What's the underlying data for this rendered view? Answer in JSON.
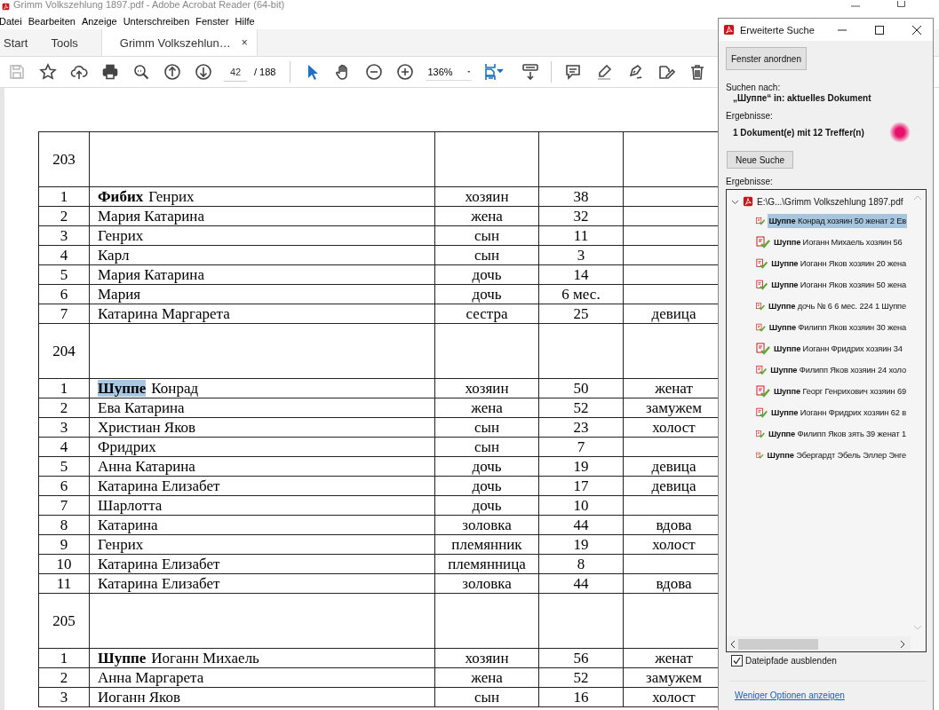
{
  "app_window": {
    "title": "Grimm Volkszehlung 1897.pdf - Adobe Acrobat Reader (64-bit)"
  },
  "menu": [
    "Datei",
    "Bearbeiten",
    "Anzeige",
    "Unterschreiben",
    "Fenster",
    "Hilfe"
  ],
  "tabs": [
    {
      "label": "Start",
      "selected": false
    },
    {
      "label": "Tools",
      "selected": false
    },
    {
      "label": "Grimm Volkszehlun…",
      "selected": true,
      "close": "×"
    }
  ],
  "toolbar": [
    {
      "kind": "save",
      "active": false,
      "disabled": true
    },
    {
      "kind": "bookmark",
      "active": false,
      "disabled": false
    },
    {
      "kind": "upload",
      "active": false,
      "disabled": false
    },
    {
      "kind": "print",
      "active": false,
      "disabled": false
    },
    {
      "kind": "find",
      "active": false,
      "disabled": false
    },
    {
      "kind": "prev",
      "active": false,
      "disabled": false
    },
    {
      "kind": "next",
      "active": false,
      "disabled": false
    },
    {
      "kind": "page",
      "value": "42",
      "total": "/ 188"
    },
    {
      "kind": "separator"
    },
    {
      "kind": "select",
      "active": true,
      "disabled": false
    },
    {
      "kind": "hand",
      "active": false,
      "disabled": false
    },
    {
      "kind": "zoomout",
      "active": false,
      "disabled": false
    },
    {
      "kind": "zoomin",
      "active": false,
      "disabled": false
    },
    {
      "kind": "zoom",
      "value": "136%"
    },
    {
      "kind": "fit",
      "active": true,
      "disabled": false
    },
    {
      "kind": "scroll",
      "active": false,
      "disabled": false
    },
    {
      "kind": "separator"
    },
    {
      "kind": "comment",
      "active": false,
      "disabled": false
    },
    {
      "kind": "highlight",
      "active": false,
      "disabled": false
    },
    {
      "kind": "sign",
      "active": false,
      "disabled": false
    },
    {
      "kind": "fill",
      "active": false,
      "disabled": false
    },
    {
      "kind": "delete",
      "active": false,
      "disabled": false
    }
  ],
  "document": {
    "rows": [
      {
        "kind": "group",
        "num": "203"
      },
      {
        "kind": "person",
        "num": "1",
        "surname": "Фибих",
        "given": "Генрих",
        "role": "хозяин",
        "age": "38",
        "hit": false
      },
      {
        "kind": "person",
        "num": "2",
        "given": "Мария Катарина",
        "role": "жена",
        "age": "32"
      },
      {
        "kind": "person",
        "num": "3",
        "given": "Генрих",
        "role": "сын",
        "age": "11"
      },
      {
        "kind": "person",
        "num": "4",
        "given": "Карл",
        "role": "сын",
        "age": "3"
      },
      {
        "kind": "person",
        "num": "5",
        "given": "Мария Катарина",
        "role": "дочь",
        "age": "14"
      },
      {
        "kind": "person",
        "num": "6",
        "given": "Мария",
        "role": "дочь",
        "age": "6 мес."
      },
      {
        "kind": "person",
        "num": "7",
        "given": "Катарина Маргарета",
        "role": "сестра",
        "age": "25",
        "status": "девица"
      },
      {
        "kind": "group",
        "num": "204"
      },
      {
        "kind": "person",
        "num": "1",
        "surname": "Шуппе",
        "given": "Конрад",
        "role": "хозяин",
        "age": "50",
        "status": "женат",
        "hit": true
      },
      {
        "kind": "person",
        "num": "2",
        "given": "Ева Катарина",
        "role": "жена",
        "age": "52",
        "status": "замужем"
      },
      {
        "kind": "person",
        "num": "3",
        "given": "Христиан Яков",
        "role": "сын",
        "age": "23",
        "status": "холост"
      },
      {
        "kind": "person",
        "num": "4",
        "given": "Фридрих",
        "role": "сын",
        "age": "7"
      },
      {
        "kind": "person",
        "num": "5",
        "given": "Анна Катарина",
        "role": "дочь",
        "age": "19",
        "status": "девица"
      },
      {
        "kind": "person",
        "num": "6",
        "given": "Катарина Елизабет",
        "role": "дочь",
        "age": "17",
        "status": "девица"
      },
      {
        "kind": "person",
        "num": "7",
        "given": "Шарлотта",
        "role": "дочь",
        "age": "10"
      },
      {
        "kind": "person",
        "num": "8",
        "given": "Катарина",
        "role": "золовка",
        "age": "44",
        "status": "вдова"
      },
      {
        "kind": "person",
        "num": "9",
        "given": "Генрих",
        "role": "племянник",
        "age": "19",
        "status": "холост"
      },
      {
        "kind": "person",
        "num": "10",
        "given": "Катарина Елизабет",
        "role": "племянница",
        "age": "8"
      },
      {
        "kind": "person",
        "num": "11",
        "given": "Катарина Елизабет",
        "role": "золовка",
        "age": "44",
        "status": "вдова"
      },
      {
        "kind": "group",
        "num": "205"
      },
      {
        "kind": "person",
        "num": "1",
        "surname": "Шуппе",
        "given": "Иоганн Михаель",
        "role": "хозяин",
        "age": "56",
        "status": "женат",
        "hit": false
      },
      {
        "kind": "person",
        "num": "2",
        "given": "Анна Маргарета",
        "role": "жена",
        "age": "52",
        "status": "замужем"
      },
      {
        "kind": "person",
        "num": "3",
        "given": "Иоганн Яков",
        "role": "сын",
        "age": "16",
        "status": "холост"
      }
    ]
  },
  "search_dialog": {
    "title": "Erweiterte Suche",
    "arrange_button": "Fenster anordnen",
    "search_label": "Suchen nach:",
    "search_query": "„Шуппе“ in: aktuelles Dokument",
    "summary_label": "Ergebnisse:",
    "summary": "1 Dokument(e) mit 12 Treffer(n)",
    "new_search_button": "Neue Suche",
    "results_label": "Ergebnisse:",
    "results": {
      "file": "E:\\G...\\Grimm Volkszehlung 1897.pdf",
      "expanded": true,
      "children": [
        {
          "term": "Шуппе",
          "context": "Конрад хозяин 50 женат 2 Ев",
          "selected": true
        },
        {
          "term": "Шуппе",
          "context": "Иоганн Михаель хозяин 56",
          "selected": false
        },
        {
          "term": "Шуппе",
          "context": "Иоганн Яков хозяин 20 жена",
          "selected": false
        },
        {
          "term": "Шуппе",
          "context": "Иоганн Яков хозяин 50 жена",
          "selected": false
        },
        {
          "term": "Шуппе",
          "context": "дочь № 6 6 мес. 224 1 Шуппе",
          "selected": false
        },
        {
          "term": "Шуппе",
          "context": "Филипп Яков хозяин 30 жена",
          "selected": false
        },
        {
          "term": "Шуппе",
          "context": "Иоганн Фридрих хозяин 34",
          "selected": false
        },
        {
          "term": "Шуппе",
          "context": "Филипп Яков хозяин 24 холо",
          "selected": false
        },
        {
          "term": "Шуппе",
          "context": "Георг Генрихович хозяин 69",
          "selected": false
        },
        {
          "term": "Шуппе",
          "context": "Иоганн Фридрих хозяин 62 в",
          "selected": false
        },
        {
          "term": "Шуппе",
          "context": "Филипп Яков зять 39 женат 1",
          "selected": false
        },
        {
          "term": "Шуппе",
          "context": "Эбергардт Эбель Эллер Энге",
          "selected": false
        }
      ]
    },
    "hide_paths": {
      "label": "Dateipfade ausblenden",
      "checked": true
    },
    "fewer_options_link": "Weniger Optionen anzeigen"
  }
}
